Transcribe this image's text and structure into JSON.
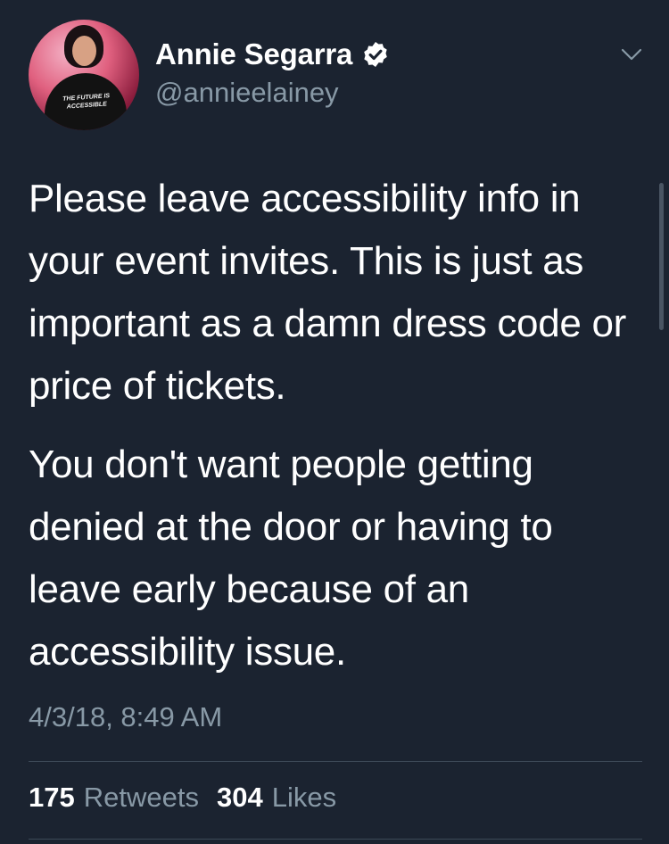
{
  "tweet": {
    "author": {
      "display_name": "Annie Segarra",
      "handle": "@annieelainey",
      "verified": true,
      "avatar_shirt_text": "THE FUTURE IS ACCESSIBLE"
    },
    "paragraphs": [
      "Please leave accessibility info in your event invites. This is just as important as a damn dress code or price of tickets.",
      "You don't want people getting denied at the door or having to leave early because of an accessibility issue."
    ],
    "timestamp": "4/3/18, 8:49 AM",
    "stats": {
      "retweets_count": "175",
      "retweets_label": "Retweets",
      "likes_count": "304",
      "likes_label": "Likes"
    }
  },
  "icons": {
    "verified": "verified-badge-icon",
    "menu": "chevron-down-icon"
  },
  "colors": {
    "background": "#1b2330",
    "primary_text": "#ffffff",
    "secondary_text": "#8899a6",
    "divider": "#3d4957"
  }
}
